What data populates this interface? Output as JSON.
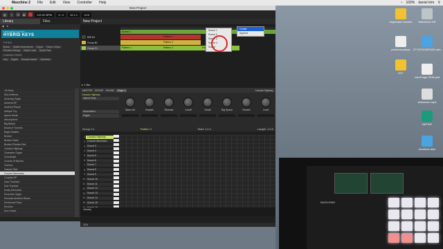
{
  "menubar": {
    "app": "Maschine 2",
    "items": [
      "File",
      "Edit",
      "View",
      "Controller",
      "Help"
    ],
    "right": [
      "100%",
      "daniel trim"
    ]
  },
  "window": {
    "title": "New Project"
  },
  "header": {
    "bpm": "120.00 BPM",
    "meter": "4 / 4",
    "pos": "10:1:1",
    "grid": "1/16"
  },
  "browser": {
    "tabs": [
      "Library",
      "Files"
    ],
    "instrument": {
      "vendor": "MASCHINE FACTORY",
      "name": "HYBRID KEYS"
    },
    "types_title": "TYPES",
    "types": [
      "Brass",
      "Mallet Instruments",
      "Organ",
      "Piano / Keys",
      "Plucked Strings",
      "Synth Lead",
      "Synth Pad"
    ],
    "chars_title": "CHARACTERS",
    "chars": [
      "Airy",
      "Digital",
      "Sample-based",
      "Synthetic"
    ],
    "presets": [
      "7th Keys",
      "80s Anthems",
      "Amazing Organ",
      "Ambient EP",
      "Ambient Planet",
      "Antique Toy",
      "Apnea Mode",
      "Atmospheric",
      "Big Ballad",
      "Bowls of Tunnels",
      "Bright Mallets",
      "Broken",
      "Broken Heart",
      "Broken Rhodes Pad",
      "Canada Highway",
      "Character Organ",
      "Chordmate",
      "Chords Of Barrels",
      "Cinema",
      "Classic Ride",
      "Concert Memories",
      "Crossfly EP",
      "Dark Tracksim",
      "Dub Tracklax",
      "Dusty Memories",
      "Eccentric Organ",
      "Electrick Ambient Works",
      "Emotional Piano",
      "Emotion",
      "Euro Scant"
    ],
    "selected": "Concert Memories"
  },
  "arranger": {
    "title": "New Project",
    "groups": [
      "808 Kit",
      "Group B1",
      "Group C1"
    ],
    "scenes": [
      "Scene 1"
    ],
    "patterns": [
      "Pattern 1",
      "Pattern 2",
      "Pattern 1",
      "Pattern 2",
      "Pattern 2"
    ]
  },
  "menu1": [
    "Scene 1",
    "Scene 2",
    "Scene 3",
    "Scene 4",
    "Scene"
  ],
  "menu2": [
    "Create",
    "Append"
  ],
  "ctrl": {
    "sound": "Canada Highway",
    "plugin": "Hybrid Keys",
    "page": "Page 1",
    "preset": "Canada Highway",
    "left": [
      "Automation",
      "Pages"
    ],
    "knobs": [
      "Warm Alt",
      "Sustain",
      "Release",
      "Cutoff",
      "Detail",
      "Big Space",
      "Reverb",
      "Level"
    ]
  },
  "group": {
    "name": "Group C1",
    "pattern": "Pattern 2",
    "start": "Start: 1:1:1",
    "length": "Length: 1:0:0",
    "zoom": "Zoom: 16",
    "sounds": [
      "Canada Highway",
      "Concert Memories",
      "Sound 3",
      "Sound 4",
      "Sound 5",
      "Sound 6",
      "Sound 7",
      "Sound 8",
      "Sound 9",
      "Sound 10",
      "Sound 11",
      "Sound 12",
      "Sound 13",
      "Sound 14",
      "Sound 15",
      "Sound 16"
    ],
    "velocity": "Velocity",
    "footer": "1/16"
  },
  "desktop": [
    "seguridad maxima",
    "Macintosh HD",
    "primeros pasos",
    "DT DESCARGAS alex",
    "2DT",
    "cutoff logo 2015.psd",
    "actioncam.mp4",
    "NATIVE",
    "escritorio alex"
  ],
  "device": {
    "name": "MASCHINE"
  }
}
